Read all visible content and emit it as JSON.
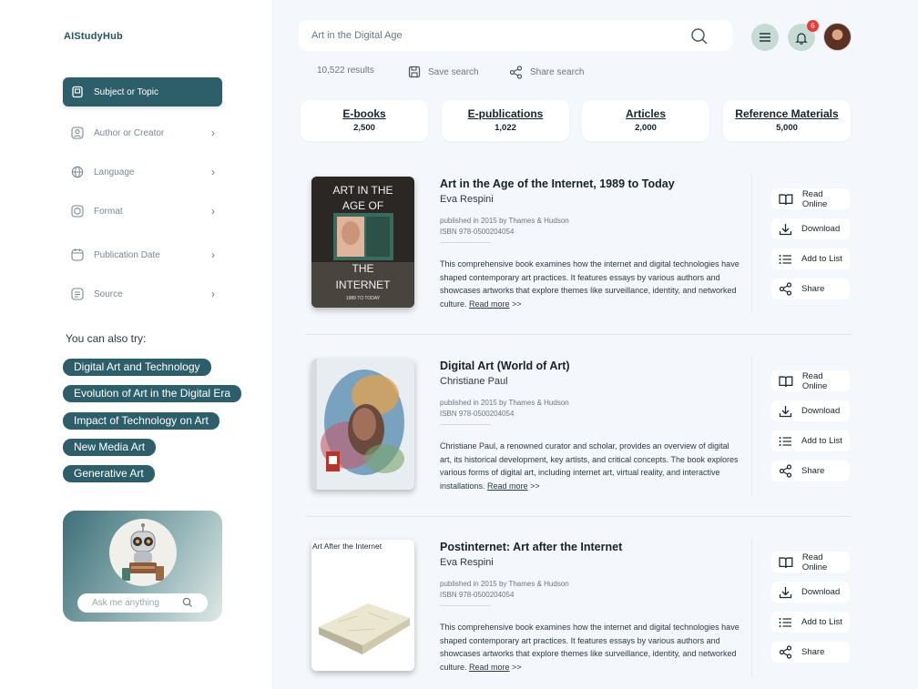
{
  "app": {
    "name": "AIStudyHub"
  },
  "sidebar": {
    "filters": [
      {
        "label": "Subject or Topic",
        "icon": "book-icon",
        "active": true
      },
      {
        "label": "Author or Creator",
        "icon": "user-icon",
        "active": false
      },
      {
        "label": "Language",
        "icon": "globe-icon",
        "active": false
      },
      {
        "label": "Format",
        "icon": "cube-icon",
        "active": false
      },
      {
        "label": "Publication Date",
        "icon": "calendar-icon",
        "active": false
      },
      {
        "label": "Source",
        "icon": "source-icon",
        "active": false
      }
    ],
    "try_title": "You can also try:",
    "suggestions": [
      "Digital Art and Technology",
      "Evolution of Art in the Digital Era",
      "Impact of Technology on Art",
      "New Media Art",
      "Generative Art"
    ],
    "assistant": {
      "placeholder": "Ask me anything"
    }
  },
  "search": {
    "value": "Art in the Digital Age"
  },
  "header": {
    "notification_count": "6"
  },
  "meta": {
    "results": "10,522 results",
    "save": "Save search",
    "share": "Share search"
  },
  "stats": [
    {
      "label": "E-books",
      "count": "2,500"
    },
    {
      "label": "E-publications",
      "count": "1,022"
    },
    {
      "label": "Articles",
      "count": "2,000"
    },
    {
      "label": "Reference Materials",
      "count": "5,000"
    }
  ],
  "actions": {
    "read": "Read Online",
    "download": "Download",
    "add": "Add to List",
    "share": "Share"
  },
  "results": [
    {
      "title": "Art in the Age of the Internet, 1989 to Today",
      "author": "Eva Respini",
      "published": "published in 2015 by Thames & Hudson",
      "isbn": "ISBN 978-0500204054",
      "description": "This comprehensive book examines how the internet and digital technologies have shaped contemporary art practices. It features essays by various authors and showcases artworks that explore themes like surveillance, identity, and networked culture. ",
      "read_more": "Read more",
      "arrows": " >>",
      "cover": {
        "line1": "ART IN THE",
        "line2": "AGE OF",
        "line3": "THE",
        "line4": "INTERNET",
        "line5": "1989 TO TODAY"
      }
    },
    {
      "title": "Digital Art (World of Art)",
      "author": "Christiane Paul",
      "published": "published in 2015 by Thames & Hudson",
      "isbn": "ISBN 978-0500204054",
      "description": "Christiane Paul, a renowned curator and scholar, provides an overview of digital art, its historical development, key artists, and critical concepts. The book explores various forms of digital art, including internet art, virtual reality, and interactive installations. ",
      "read_more": "Read more",
      "arrows": " >>"
    },
    {
      "title": "Postinternet: Art after the Internet",
      "author": "Eva Respini",
      "published": "published in 2015 by Thames & Hudson",
      "isbn": "ISBN 978-0500204054",
      "description": "This comprehensive book examines how the internet and digital technologies have shaped contemporary art practices. It features essays by various authors and showcases artworks that explore themes like surveillance, identity, and networked culture. ",
      "read_more": "Read more",
      "arrows": " >>",
      "cover": {
        "line1": "Art After the Internet"
      }
    }
  ]
}
